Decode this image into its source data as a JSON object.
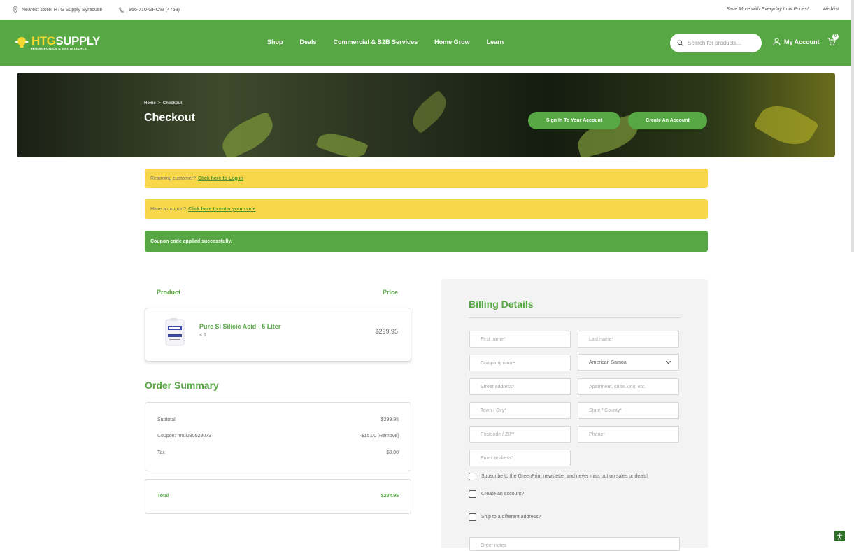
{
  "topbar": {
    "store": "Nearest store: HTG Supply Syracuse",
    "phone": "866-710-GROW (4769)",
    "promo": "Save More with Everyday Low Prices!",
    "wishlist": "Wishlist"
  },
  "header": {
    "logo_left": "HTG",
    "logo_right": "SUPPLY",
    "logo_tag": "HYDROPONICS & GROW LIGHTS",
    "nav": [
      "Shop",
      "Deals",
      "Commercial & B2B Services",
      "Home Grow",
      "Learn"
    ],
    "search_placeholder": "Search for products...",
    "account": "My Account",
    "cart_count": "0"
  },
  "hero": {
    "breadcrumb_home": "Home",
    "breadcrumb_sep": ">",
    "breadcrumb_current": "Checkout",
    "title": "Checkout",
    "sign_in": "Sign In To Your Account",
    "create": "Create An Account"
  },
  "notices": {
    "returning_text": "Returning customer?",
    "returning_link": "Click here to Log in",
    "coupon_text": "Have a coupon?",
    "coupon_link": "Click here to enter your code",
    "applied": "Coupon code applied successfully."
  },
  "cart": {
    "col_product": "Product",
    "col_price": "Price",
    "item_name": "Pure Si Silicic Acid - 5 Liter",
    "item_qty": "× 1",
    "item_price": "$299.95"
  },
  "summary": {
    "title": "Order Summary",
    "subtotal_label": "Subtotal",
    "subtotal_value": "$299.95",
    "coupon_label": "Coupon: rmul230928073",
    "coupon_value": "-$15.00 [Remove]",
    "tax_label": "Tax",
    "tax_value": "$0.00",
    "total_label": "Total",
    "total_value": "$284.95"
  },
  "billing": {
    "title": "Billing Details",
    "first_name": "First name*",
    "last_name": "Last name*",
    "company": "Company name",
    "country": "American Samoa",
    "street": "Street address*",
    "apartment": "Apartment, suite, unit, etc.",
    "city": "Town / City*",
    "state": "State / County*",
    "postcode": "Postcode / ZIP*",
    "phone": "Phone*",
    "email": "Email address*",
    "newsletter": "Subscribe to the GreenPrint newsletter and never miss out on sales or deals!",
    "create_account": "Create an account?",
    "ship_different": "Ship to a different address?",
    "order_notes": "Order notes"
  }
}
